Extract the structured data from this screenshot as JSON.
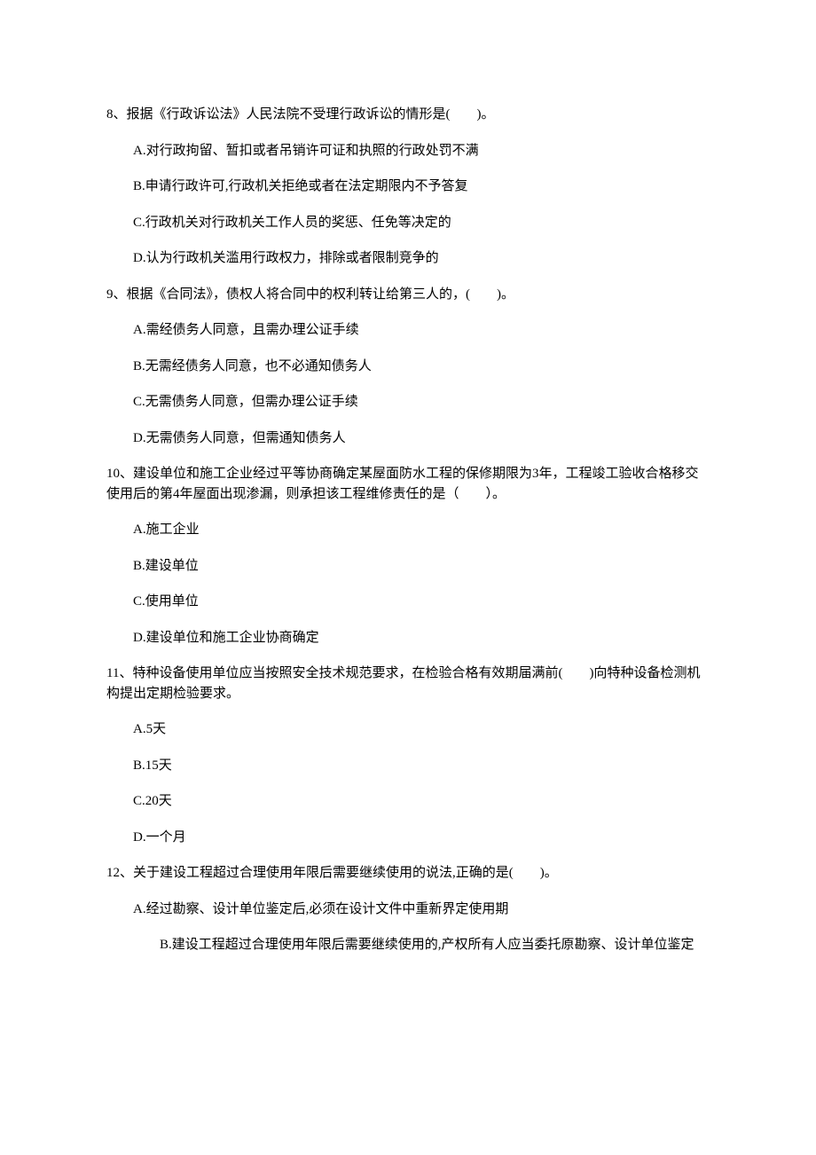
{
  "questions": [
    {
      "num": "8",
      "text": "8、报据《行政诉讼法》人民法院不受理行政诉讼的情形是(　　)。",
      "options": [
        "A.对行政拘留、暂扣或者吊销许可证和执照的行政处罚不满",
        "B.申请行政许可,行政机关拒绝或者在法定期限内不予答复",
        "C.行政机关对行政机关工作人员的奖惩、任免等决定的",
        "D.认为行政机关滥用行政权力，排除或者限制竞争的"
      ]
    },
    {
      "num": "9",
      "text": "9、根据《合同法》，债权人将合同中的权利转让给第三人的，(　　)。",
      "options": [
        "A.需经债务人同意，且需办理公证手续",
        "B.无需经债务人同意，也不必通知债务人",
        "C.无需债务人同意，但需办理公证手续",
        "D.无需债务人同意，但需通知债务人"
      ]
    },
    {
      "num": "10",
      "text": "10、建设单位和施工企业经过平等协商确定某屋面防水工程的保修期限为3年，工程竣工验收合格移交使用后的第4年屋面出现渗漏，则承担该工程维修责任的是（　　）。",
      "options": [
        "A.施工企业",
        "B.建设单位",
        "C.使用单位",
        "D.建设单位和施工企业协商确定"
      ]
    },
    {
      "num": "11",
      "text": "11、特种设备使用单位应当按照安全技术规范要求，在检验合格有效期届满前(　　)向特种设备检测机构提出定期检验要求。",
      "options": [
        "A.5天",
        "B.15天",
        "C.20天",
        "D.一个月"
      ]
    },
    {
      "num": "12",
      "text": "12、关于建设工程超过合理使用年限后需要继续使用的说法,正确的是(　　)。",
      "options": [
        "A.经过勘察、设计单位鉴定后,必须在设计文件中重新界定使用期",
        "B.建设工程超过合理使用年限后需要继续使用的,产权所有人应当委托原勘察、设计单位鉴定"
      ]
    }
  ]
}
